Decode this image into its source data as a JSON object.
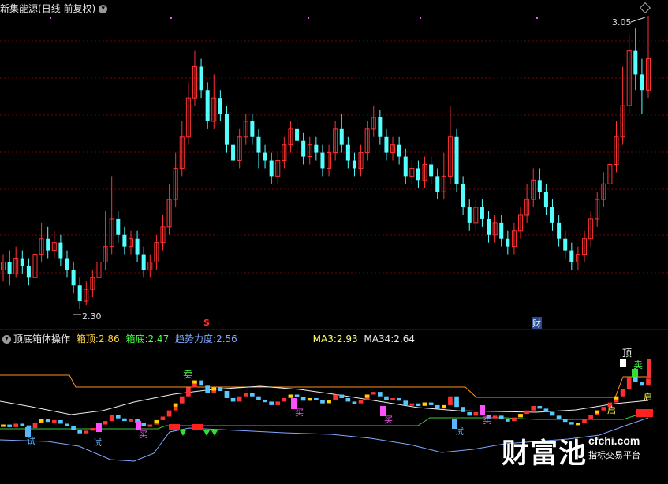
{
  "main_chart": {
    "title": "新集能源",
    "period_label": "(日线 前复权)",
    "high_label": "3.05",
    "low_label": "2.30",
    "marker_s": "S",
    "marker_cai": "财",
    "bull_color": "#ff3232",
    "bear_color": "#54ffff"
  },
  "indicator": {
    "name": "顶底箱体操作",
    "box_top_label": "箱顶:",
    "box_top_value": "2.86",
    "box_bottom_label": "箱底:",
    "box_bottom_value": "2.47",
    "trend_label": "趋势力度:",
    "trend_value": "2.56",
    "ma3_label": "MA3:",
    "ma3_value": "2.93",
    "ma34_label": "MA34:",
    "ma34_value": "2.64",
    "signal_sell": "卖",
    "signal_buy": "买",
    "signal_try": "试",
    "signal_top": "顶",
    "signal_hold": "启"
  },
  "watermark": {
    "brand": "财富池",
    "site": "cfchi.com",
    "slogan": "指标交易平台"
  },
  "chart_data": {
    "type": "candlestick",
    "y_low": 2.3,
    "y_high": 3.05,
    "candles": [
      [
        2.4,
        2.42,
        2.37,
        2.44
      ],
      [
        2.42,
        2.39,
        2.36,
        2.45
      ],
      [
        2.39,
        2.43,
        2.38,
        2.46
      ],
      [
        2.43,
        2.41,
        2.39,
        2.45
      ],
      [
        2.41,
        2.38,
        2.36,
        2.43
      ],
      [
        2.38,
        2.44,
        2.37,
        2.47
      ],
      [
        2.44,
        2.48,
        2.42,
        2.52
      ],
      [
        2.48,
        2.45,
        2.43,
        2.51
      ],
      [
        2.45,
        2.47,
        2.43,
        2.5
      ],
      [
        2.47,
        2.43,
        2.41,
        2.49
      ],
      [
        2.43,
        2.4,
        2.38,
        2.45
      ],
      [
        2.4,
        2.36,
        2.34,
        2.42
      ],
      [
        2.36,
        2.32,
        2.3,
        2.38
      ],
      [
        2.32,
        2.35,
        2.31,
        2.37
      ],
      [
        2.35,
        2.38,
        2.33,
        2.4
      ],
      [
        2.38,
        2.42,
        2.36,
        2.44
      ],
      [
        2.42,
        2.46,
        2.4,
        2.55
      ],
      [
        2.46,
        2.53,
        2.44,
        2.64
      ],
      [
        2.53,
        2.49,
        2.47,
        2.55
      ],
      [
        2.49,
        2.46,
        2.44,
        2.51
      ],
      [
        2.46,
        2.48,
        2.44,
        2.5
      ],
      [
        2.48,
        2.44,
        2.42,
        2.5
      ],
      [
        2.44,
        2.4,
        2.38,
        2.46
      ],
      [
        2.4,
        2.42,
        2.38,
        2.44
      ],
      [
        2.42,
        2.47,
        2.4,
        2.49
      ],
      [
        2.47,
        2.51,
        2.45,
        2.54
      ],
      [
        2.51,
        2.58,
        2.49,
        2.62
      ],
      [
        2.58,
        2.66,
        2.56,
        2.7
      ],
      [
        2.66,
        2.74,
        2.64,
        2.78
      ],
      [
        2.74,
        2.84,
        2.72,
        2.88
      ],
      [
        2.84,
        2.92,
        2.82,
        2.96
      ],
      [
        2.92,
        2.86,
        2.84,
        2.94
      ],
      [
        2.86,
        2.78,
        2.76,
        2.88
      ],
      [
        2.78,
        2.84,
        2.76,
        2.9
      ],
      [
        2.84,
        2.8,
        2.78,
        2.86
      ],
      [
        2.8,
        2.72,
        2.7,
        2.82
      ],
      [
        2.72,
        2.68,
        2.66,
        2.74
      ],
      [
        2.68,
        2.74,
        2.66,
        2.76
      ],
      [
        2.74,
        2.78,
        2.72,
        2.8
      ],
      [
        2.78,
        2.74,
        2.72,
        2.8
      ],
      [
        2.74,
        2.7,
        2.66,
        2.76
      ],
      [
        2.7,
        2.68,
        2.66,
        2.72
      ],
      [
        2.68,
        2.64,
        2.62,
        2.7
      ],
      [
        2.64,
        2.68,
        2.62,
        2.7
      ],
      [
        2.68,
        2.72,
        2.66,
        2.74
      ],
      [
        2.72,
        2.76,
        2.7,
        2.78
      ],
      [
        2.76,
        2.73,
        2.7,
        2.78
      ],
      [
        2.73,
        2.69,
        2.67,
        2.75
      ],
      [
        2.69,
        2.72,
        2.67,
        2.74
      ],
      [
        2.72,
        2.7,
        2.68,
        2.74
      ],
      [
        2.7,
        2.66,
        2.64,
        2.72
      ],
      [
        2.66,
        2.7,
        2.64,
        2.72
      ],
      [
        2.7,
        2.76,
        2.68,
        2.78
      ],
      [
        2.76,
        2.72,
        2.7,
        2.8
      ],
      [
        2.72,
        2.68,
        2.66,
        2.74
      ],
      [
        2.68,
        2.66,
        2.64,
        2.7
      ],
      [
        2.66,
        2.7,
        2.64,
        2.72
      ],
      [
        2.7,
        2.76,
        2.68,
        2.78
      ],
      [
        2.76,
        2.79,
        2.74,
        2.82
      ],
      [
        2.79,
        2.74,
        2.72,
        2.81
      ],
      [
        2.74,
        2.7,
        2.68,
        2.76
      ],
      [
        2.7,
        2.72,
        2.68,
        2.74
      ],
      [
        2.72,
        2.69,
        2.67,
        2.74
      ],
      [
        2.69,
        2.64,
        2.62,
        2.71
      ],
      [
        2.64,
        2.66,
        2.62,
        2.68
      ],
      [
        2.66,
        2.63,
        2.61,
        2.68
      ],
      [
        2.63,
        2.67,
        2.61,
        2.69
      ],
      [
        2.67,
        2.64,
        2.62,
        2.69
      ],
      [
        2.64,
        2.6,
        2.58,
        2.66
      ],
      [
        2.6,
        2.64,
        2.58,
        2.7
      ],
      [
        2.64,
        2.74,
        2.62,
        2.82
      ],
      [
        2.74,
        2.62,
        2.6,
        2.76
      ],
      [
        2.62,
        2.56,
        2.54,
        2.64
      ],
      [
        2.56,
        2.52,
        2.5,
        2.58
      ],
      [
        2.52,
        2.56,
        2.5,
        2.58
      ],
      [
        2.56,
        2.53,
        2.51,
        2.58
      ],
      [
        2.53,
        2.49,
        2.47,
        2.55
      ],
      [
        2.49,
        2.52,
        2.47,
        2.54
      ],
      [
        2.52,
        2.48,
        2.46,
        2.54
      ],
      [
        2.48,
        2.46,
        2.44,
        2.5
      ],
      [
        2.46,
        2.5,
        2.44,
        2.52
      ],
      [
        2.5,
        2.54,
        2.48,
        2.56
      ],
      [
        2.54,
        2.58,
        2.52,
        2.62
      ],
      [
        2.58,
        2.63,
        2.56,
        2.66
      ],
      [
        2.63,
        2.6,
        2.58,
        2.66
      ],
      [
        2.6,
        2.56,
        2.54,
        2.62
      ],
      [
        2.56,
        2.52,
        2.5,
        2.58
      ],
      [
        2.52,
        2.48,
        2.46,
        2.54
      ],
      [
        2.48,
        2.45,
        2.43,
        2.5
      ],
      [
        2.45,
        2.42,
        2.4,
        2.47
      ],
      [
        2.42,
        2.44,
        2.4,
        2.46
      ],
      [
        2.44,
        2.48,
        2.42,
        2.5
      ],
      [
        2.48,
        2.53,
        2.46,
        2.55
      ],
      [
        2.53,
        2.58,
        2.51,
        2.6
      ],
      [
        2.58,
        2.62,
        2.56,
        2.65
      ],
      [
        2.62,
        2.67,
        2.6,
        2.7
      ],
      [
        2.67,
        2.74,
        2.65,
        2.78
      ],
      [
        2.74,
        2.82,
        2.72,
        2.92
      ],
      [
        2.82,
        2.96,
        2.8,
        3.0
      ],
      [
        2.96,
        2.9,
        2.86,
        3.02
      ],
      [
        2.9,
        2.86,
        2.8,
        2.94
      ],
      [
        2.86,
        2.94,
        2.84,
        3.05
      ]
    ]
  }
}
